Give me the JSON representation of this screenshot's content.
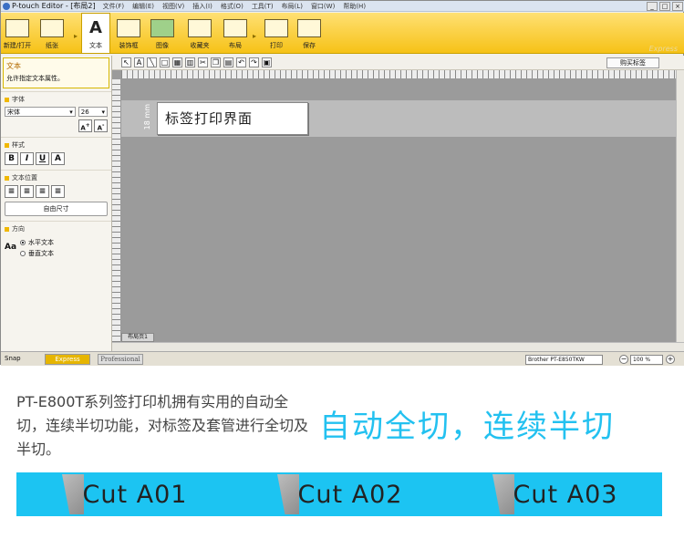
{
  "window": {
    "title": "P-touch Editor - [布局2]",
    "menus": [
      "文件(F)",
      "编辑(E)",
      "视图(V)",
      "插入(I)",
      "格式(O)",
      "工具(T)",
      "布局(L)",
      "窗口(W)",
      "帮助(H)"
    ],
    "controls": [
      "_",
      "□",
      "×"
    ]
  },
  "ribbon": {
    "buttons": [
      {
        "label": "新建/打开"
      },
      {
        "label": "纸张"
      },
      {
        "label": "文本",
        "active": true
      },
      {
        "label": "装饰框"
      },
      {
        "label": "图像"
      },
      {
        "label": "收藏夹"
      },
      {
        "label": "布局"
      },
      {
        "label": "打印"
      },
      {
        "label": "保存"
      }
    ],
    "brand": "Express"
  },
  "left_panel": {
    "tip_title": "文本",
    "tip_desc": "允许指定文本属性。",
    "font_section": "字体",
    "font_name": "宋体",
    "font_size": "26",
    "style_section": "样式",
    "style_buttons": [
      "B",
      "I",
      "U",
      "A"
    ],
    "position_section": "文本位置",
    "free_size_label": "自由尺寸",
    "direction_section": "方向",
    "direction_horizontal": "水平文本",
    "direction_vertical": "垂直文本"
  },
  "toolbar": {
    "buy_label": "购买标签"
  },
  "canvas": {
    "label_text": "标签打印界面",
    "tape_size": "18 mm",
    "page_tab": "布局页1"
  },
  "statusbar": {
    "snap": "Snap",
    "mode_express": "Express",
    "mode_professional": "Professional",
    "printer": "Brother PT-E850TKW",
    "zoom": "100 %"
  },
  "promo": {
    "description": "PT-E800T系列签打印机拥有实用的自动全切，连续半切功能，对标签及套管进行全切及半切。",
    "headline": "自动全切，连续半切",
    "cut_labels": [
      "Cut A01",
      "Cut A02",
      "Cut A03"
    ]
  },
  "colors": {
    "ribbon": "#f6c217",
    "accent_blue": "#1cc4f2",
    "headline_blue": "#23c1f0"
  }
}
